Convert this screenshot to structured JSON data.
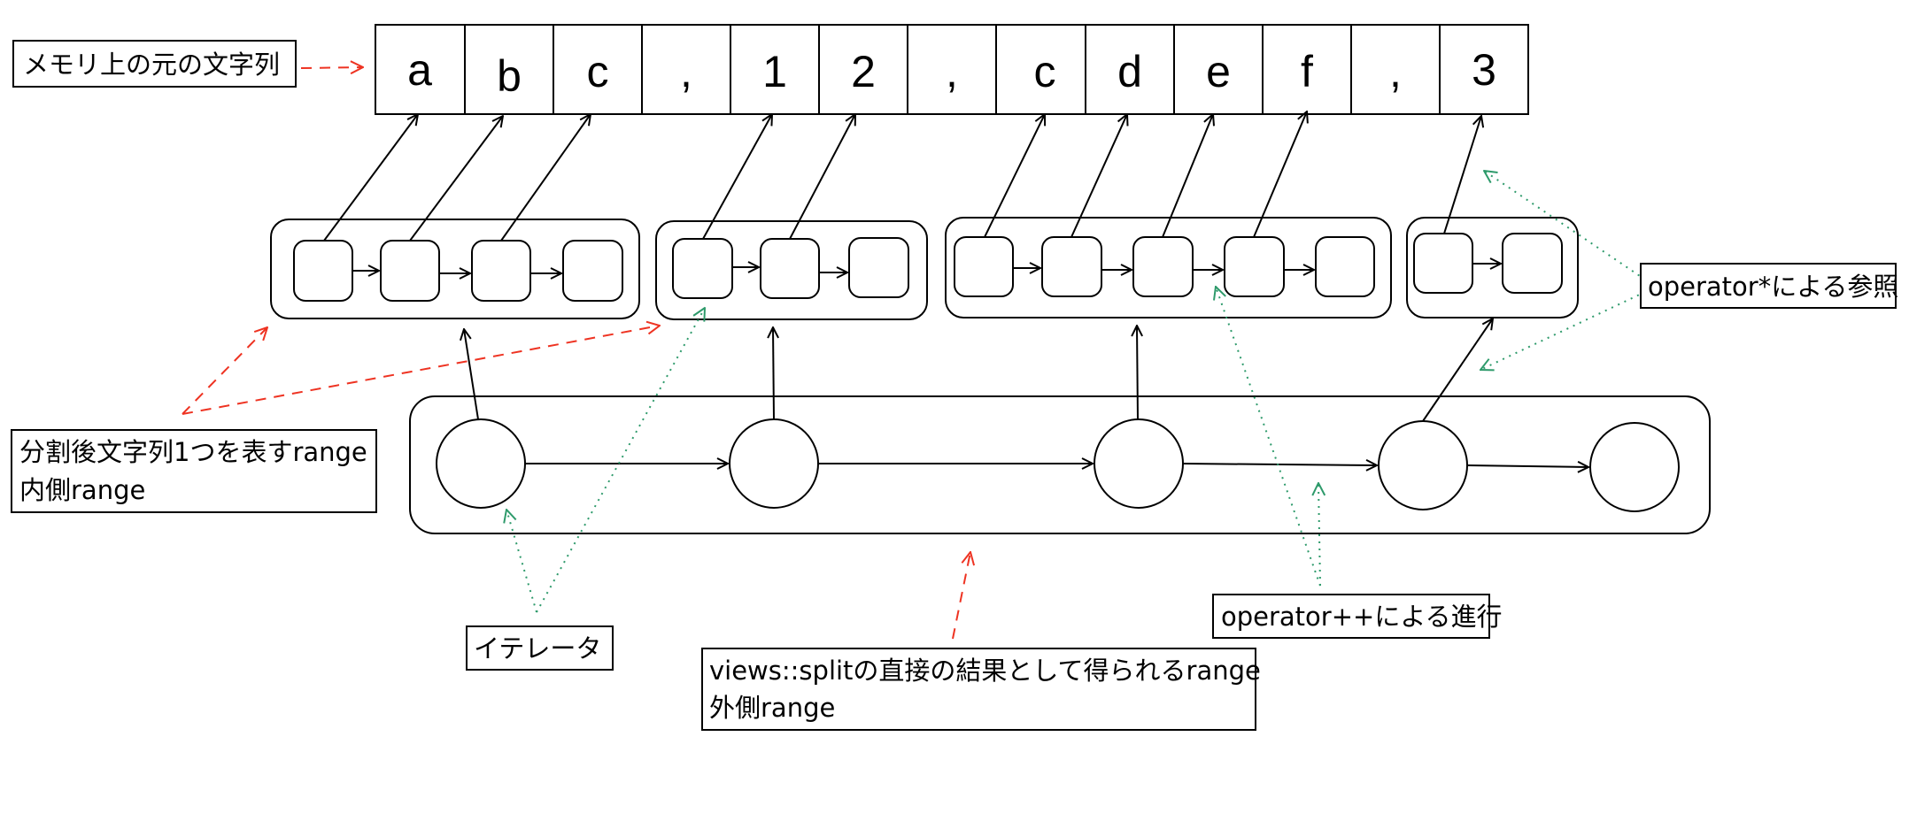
{
  "memory": {
    "chars": [
      "a",
      "b",
      "c",
      ",",
      "1",
      "2",
      ",",
      "c",
      "d",
      "e",
      "f",
      ",",
      "3"
    ]
  },
  "labels": {
    "memory_string": "メモリ上の元の文字列",
    "inner_range_line1": "分割後文字列1つを表すrange",
    "inner_range_line2": "内側range",
    "operator_deref": "operator*による参照",
    "iterator": "イテレータ",
    "operator_increment": "operator++による進行",
    "outer_range_line1": "views::splitの直接の結果として得られるrange",
    "outer_range_line2": "外側range"
  },
  "colors": {
    "arrow": "#000000",
    "annotation_red": "#ee3322",
    "annotation_green": "#2e9a6b"
  }
}
